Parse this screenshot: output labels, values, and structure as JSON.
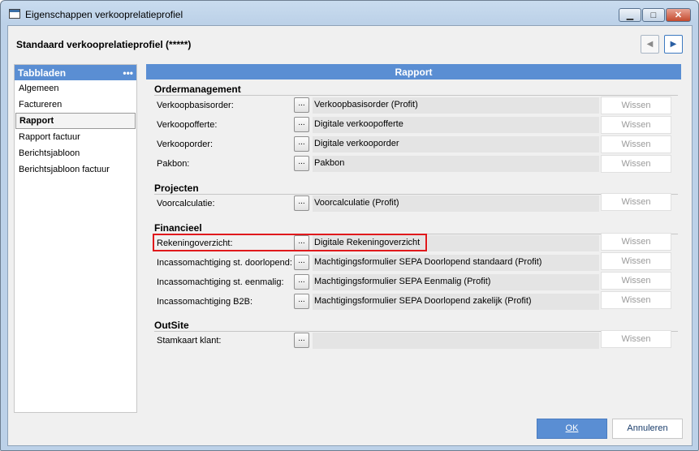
{
  "window": {
    "title": "Eigenschappen verkooprelatieprofiel",
    "minimize_glyph": "▁",
    "maximize_glyph": "□",
    "close_glyph": "✕"
  },
  "header": {
    "title": "Standaard verkooprelatieprofiel (*****)",
    "prev_icon": "◀",
    "next_icon": "▶"
  },
  "sidebar": {
    "title": "Tabbladen",
    "menu_glyph": "•••",
    "items": [
      {
        "label": "Algemeen",
        "active": false
      },
      {
        "label": "Factureren",
        "active": false
      },
      {
        "label": "Rapport",
        "active": true
      },
      {
        "label": "Rapport factuur",
        "active": false
      },
      {
        "label": "Berichtsjabloon",
        "active": false
      },
      {
        "label": "Berichtsjabloon factuur",
        "active": false
      }
    ]
  },
  "main": {
    "title": "Rapport",
    "browse_label": "...",
    "clear_label": "Wissen",
    "sections": [
      {
        "title": "Ordermanagement",
        "rows": [
          {
            "label": "Verkoopbasisorder:",
            "value": "Verkoopbasisorder (Profit)"
          },
          {
            "label": "Verkoopofferte:",
            "value": "Digitale verkoopofferte"
          },
          {
            "label": "Verkooporder:",
            "value": "Digitale verkooporder"
          },
          {
            "label": "Pakbon:",
            "value": "Pakbon"
          }
        ]
      },
      {
        "title": "Projecten",
        "rows": [
          {
            "label": "Voorcalculatie:",
            "value": "Voorcalculatie (Profit)"
          }
        ]
      },
      {
        "title": "Financieel",
        "rows": [
          {
            "label": "Rekeningoverzicht:",
            "value": "Digitale Rekeningoverzicht"
          },
          {
            "label": "Incassomachtiging st. doorlopend:",
            "value": "Machtigingsformulier SEPA Doorlopend standaard (Profit)"
          },
          {
            "label": "Incassomachtiging st. eenmalig:",
            "value": "Machtigingsformulier SEPA Eenmalig (Profit)"
          },
          {
            "label": "Incassomachtiging B2B:",
            "value": "Machtigingsformulier SEPA Doorlopend zakelijk (Profit)"
          }
        ]
      },
      {
        "title": "OutSite",
        "rows": [
          {
            "label": "Stamkaart klant:",
            "value": ""
          }
        ]
      }
    ]
  },
  "footer": {
    "ok_label": "OK",
    "cancel_label": "Annuleren"
  },
  "colors": {
    "accent": "#5a8ed3",
    "highlight": "#e0191c"
  }
}
